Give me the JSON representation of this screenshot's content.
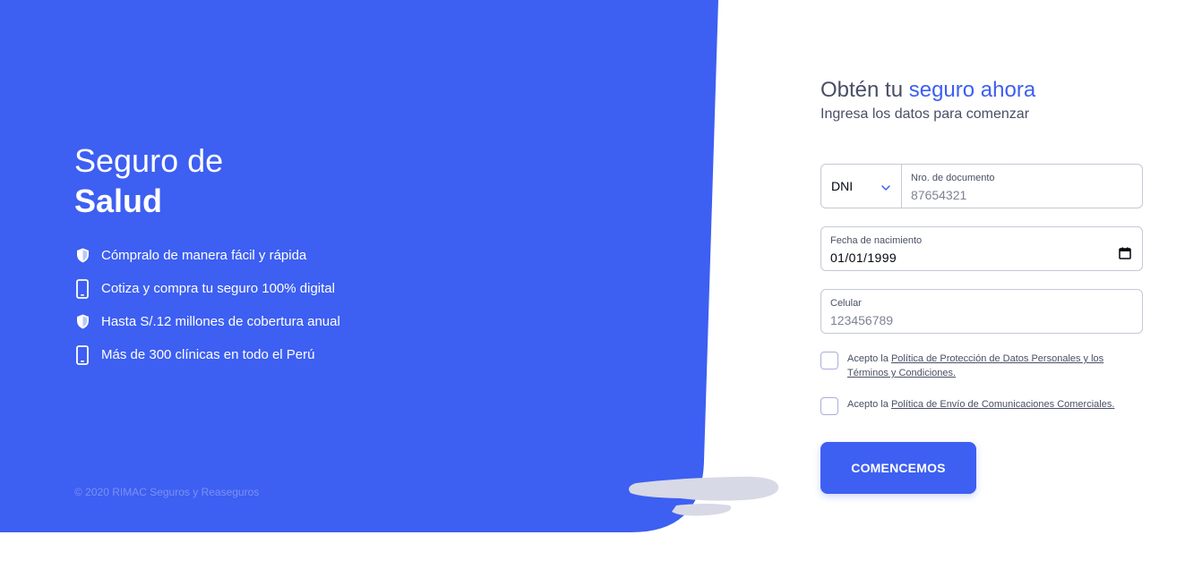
{
  "colors": {
    "brand_blue": "#3d5ff2",
    "text_dark": "#494f66",
    "border": "#c5c8d6",
    "white": "#ffffff",
    "shadow": "#d8d9e6"
  },
  "hero": {
    "title_line1": "Seguro de",
    "title_line2": "Salud",
    "benefits": [
      {
        "icon": "shield-icon",
        "text": "Cómpralo de manera fácil y rápida"
      },
      {
        "icon": "mobile-phone-icon",
        "text": "Cotiza y compra tu seguro 100% digital"
      },
      {
        "icon": "shield-icon",
        "text": "Hasta S/.12 millones de cobertura anual"
      },
      {
        "icon": "mobile-phone-icon",
        "text": "Más de 300 clínicas en todo el Perú"
      }
    ],
    "copyright": "© 2020 RIMAC Seguros y Reaseguros"
  },
  "form": {
    "title_prefix": "Obtén tu",
    "title_accent": "seguro ahora",
    "subtitle": "Ingresa los datos para comenzar",
    "doc_type": "DNI",
    "doc_number_label": "Nro. de documento",
    "doc_number_value": "87654321",
    "birthdate_label": "Fecha de nacimiento",
    "birthdate_value": "01/01/1999",
    "phone_label": "Celular",
    "phone_value": "123456789",
    "consent1_prefix": "Acepto la",
    "consent1_link": "Política de Protección de Datos Personales y los Términos y Condiciones.",
    "consent2_prefix": "Acepto la",
    "consent2_link": "Política de Envío de Comunicaciones Comerciales.",
    "submit_label": "COMENCEMOS"
  }
}
